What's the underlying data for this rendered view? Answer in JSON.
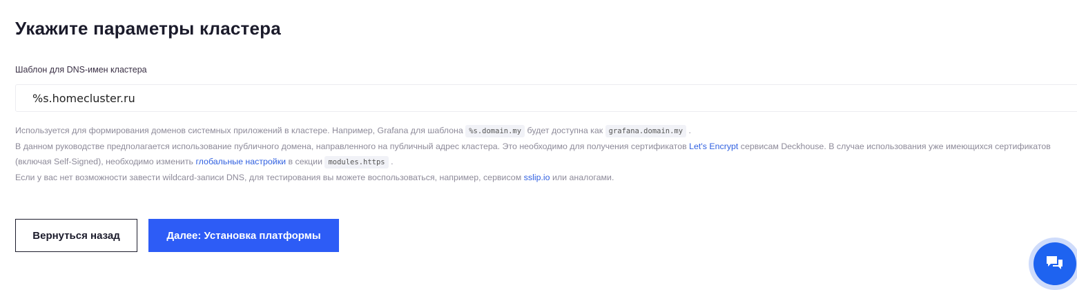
{
  "page": {
    "title": "Укажите параметры кластера"
  },
  "field": {
    "label": "Шаблон для DNS-имен кластера",
    "value": "%s.homecluster.ru"
  },
  "help": {
    "line1": {
      "t1": "Используется для формирования доменов системных приложений в кластере. Например, Grafana для шаблона ",
      "code1": "%s.domain.my",
      "t2": " будет доступна как ",
      "code2": "grafana.domain.my",
      "t3": " ."
    },
    "line2": {
      "t1": "В данном руководстве предполагается использование публичного домена, направленного на публичный адрес кластера. Это необходимо для получения сертификатов ",
      "link1": "Let's Encrypt",
      "t2": " сервисам Deckhouse. В случае использования уже имеющихся сертификатов (включая Self-Signed), необходимо изменить ",
      "link2": "глобальные настройки",
      "t3": " в секции ",
      "code": "modules.https",
      "t4": " ."
    },
    "line3": {
      "t1": "Если у вас нет возможности завести wildcard-записи DNS, для тестирования вы можете воспользоваться, например, сервисом ",
      "link": "sslip.io",
      "t2": " или аналогами."
    }
  },
  "buttons": {
    "back": "Вернуться назад",
    "next": "Далее: Установка платформы"
  },
  "colors": {
    "accent": "#2d5cf6",
    "link": "#2f5fe0",
    "chat": "#1e63f0"
  },
  "icons": {
    "chat": "chat-bubbles-icon"
  }
}
